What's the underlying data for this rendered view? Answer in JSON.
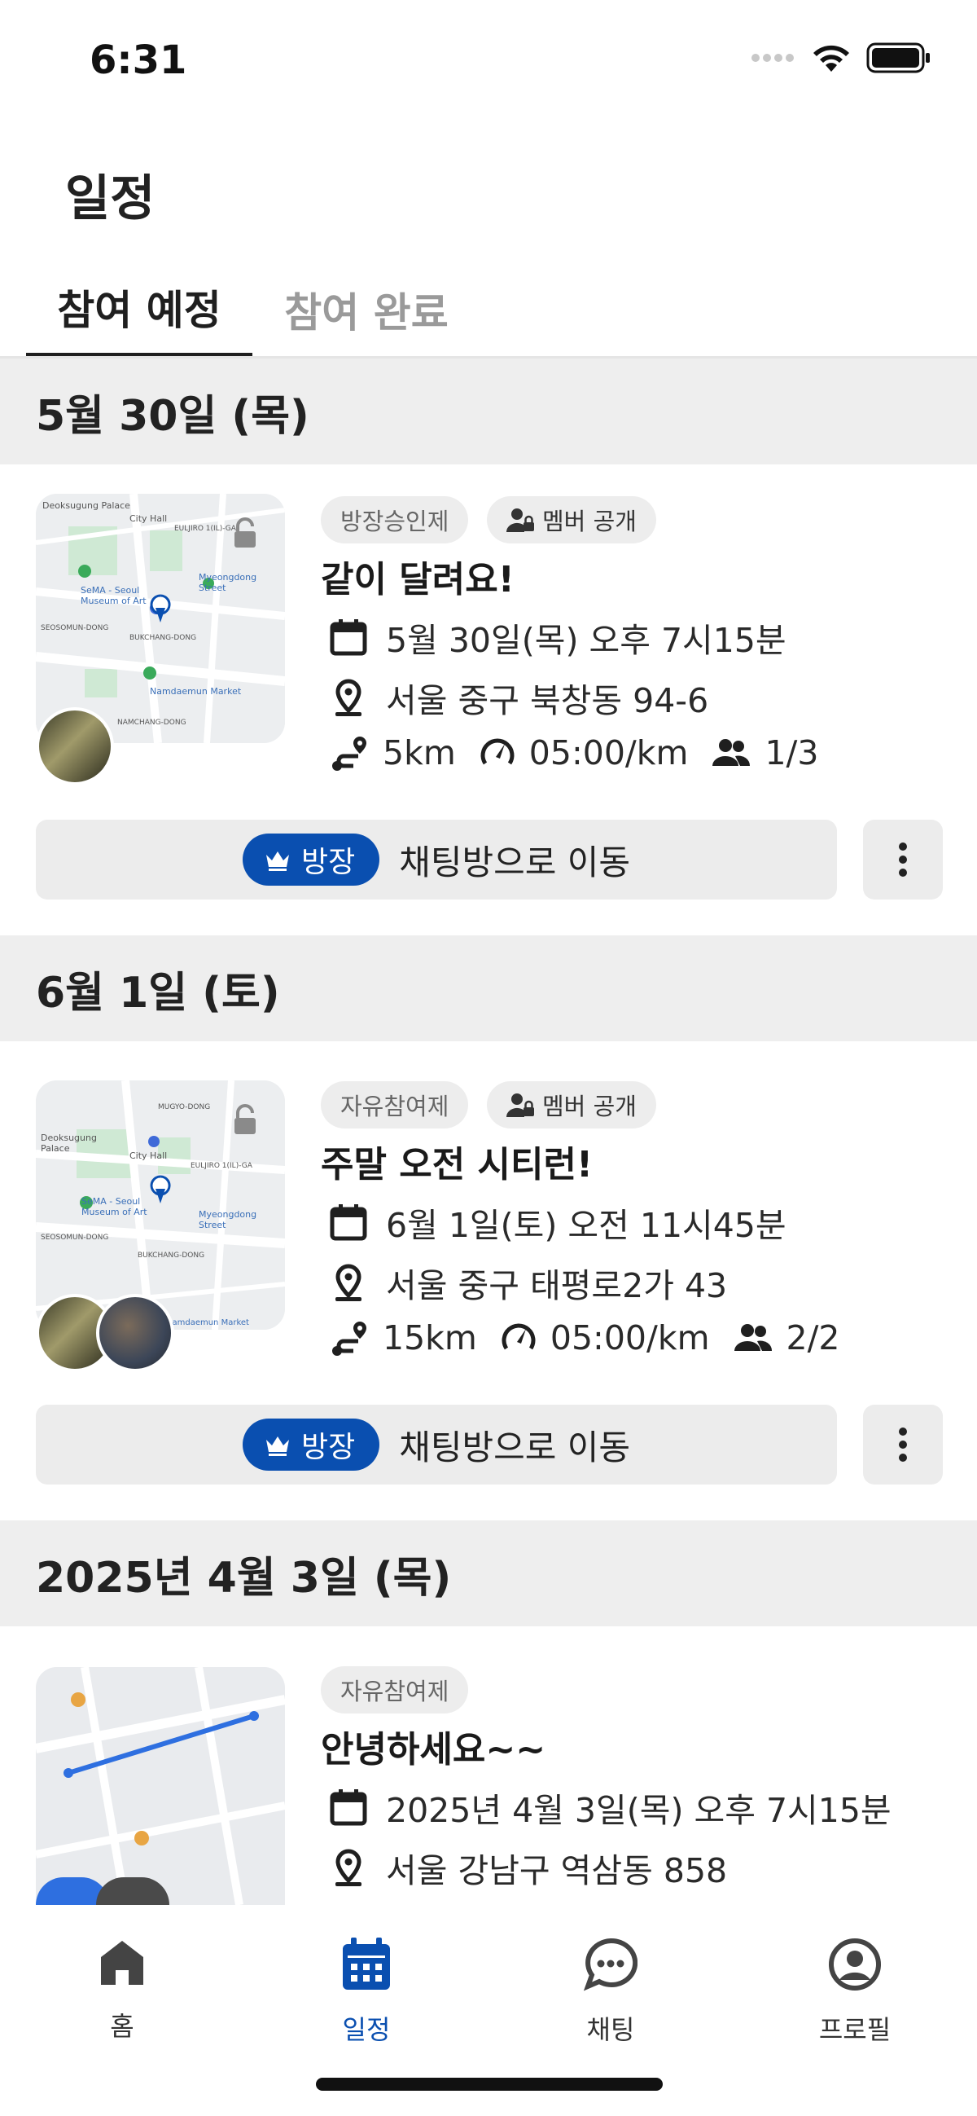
{
  "status_bar": {
    "time": "6:31"
  },
  "page": {
    "title": "일정"
  },
  "tabs": [
    {
      "label": "참여 예정",
      "active": true
    },
    {
      "label": "참여 완료",
      "active": false
    }
  ],
  "groups": [
    {
      "date": "5월 30일 (목)",
      "event": {
        "chips": [
          "방장승인제",
          "멤버 공개"
        ],
        "title": "같이 달려요!",
        "datetime": "5월 30일(목) 오후 7시15분",
        "location": "서울 중구 북창동 94-6",
        "distance": "5km",
        "pace": "05:00/km",
        "participants": "1/3",
        "locked": true,
        "host_badge": "방장",
        "chat_button": "채팅방으로 이동",
        "map_labels": [
          "Deoksugung Palace",
          "City Hall",
          "EULJIRO 1(IL)-GA",
          "SeMA - Seoul Museum of Art",
          "Myeongdong Street",
          "SEOSOMUN-DONG",
          "BUKCHANG-DONG",
          "Namdaemun Market",
          "NAMCHANG-DONG"
        ]
      }
    },
    {
      "date": "6월 1일 (토)",
      "event": {
        "chips": [
          "자유참여제",
          "멤버 공개"
        ],
        "title": "주말 오전 시티런!",
        "datetime": "6월 1일(토) 오전 11시45분",
        "location": "서울 중구 태평로2가 43",
        "distance": "15km",
        "pace": "05:00/km",
        "participants": "2/2",
        "locked": true,
        "host_badge": "방장",
        "chat_button": "채팅방으로 이동",
        "map_labels": [
          "MUGYO-DONG",
          "Deoksugung Palace",
          "City Hall",
          "EULJIRO 1(IL)-GA",
          "SeMA - Seoul Museum of Art",
          "Myeongdong Street",
          "SEOSOMUN-DONG",
          "BUKCHANG-DONG",
          "Namdaemun Market"
        ]
      }
    },
    {
      "date": "2025년 4월 3일 (목)",
      "event": {
        "chips": [
          "자유참여제"
        ],
        "title": "안녕하세요~~",
        "datetime": "2025년 4월 3일(목) 오후 7시15분",
        "location": "서울 강남구 역삼동 858"
      }
    }
  ],
  "bottom_nav": [
    {
      "label": "홈",
      "icon": "home-icon",
      "active": false
    },
    {
      "label": "일정",
      "icon": "calendar-icon",
      "active": true
    },
    {
      "label": "채팅",
      "icon": "chat-bubble-icon",
      "active": false
    },
    {
      "label": "프로필",
      "icon": "profile-icon",
      "active": false
    }
  ],
  "colors": {
    "accent": "#0a4fb0",
    "chip_bg": "#ededed",
    "section_bg": "#eeeeee"
  }
}
